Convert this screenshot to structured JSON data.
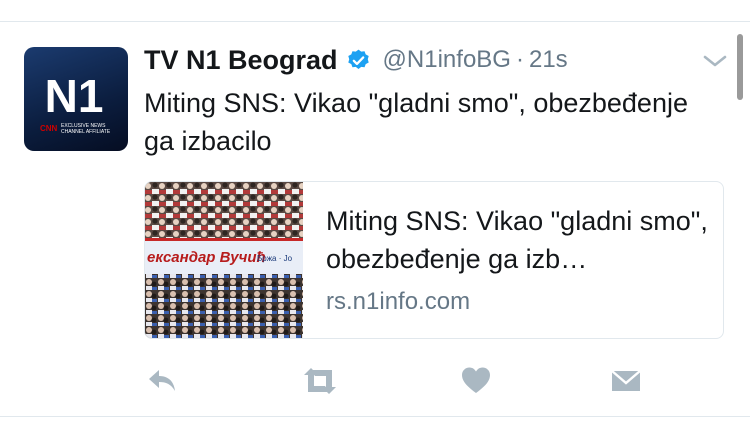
{
  "tweet": {
    "display_name": "TV N1 Beograd",
    "verified": true,
    "handle": "@N1infoBG",
    "separator": "·",
    "time": "21s",
    "text": "Miting SNS: Vikao \"gladni smo\", obezbeđenje ga izbacilo"
  },
  "avatar": {
    "logo_text": "N1",
    "sub_brand": "CNN",
    "affiliate_line1": "EXCLUSIVE NEWS",
    "affiliate_line2": "CHANNEL AFFILIATE"
  },
  "card": {
    "title": "Miting SNS: Vikao \"gladni smo\", obezbeđenje ga izb…",
    "domain": "rs.n1info.com",
    "image_banner_text": "ексaндар Вучић",
    "image_banner_small": "Бржа · Јо"
  },
  "actions": [
    {
      "name": "reply",
      "icon": "reply-icon"
    },
    {
      "name": "retweet",
      "icon": "retweet-icon"
    },
    {
      "name": "like",
      "icon": "heart-icon"
    },
    {
      "name": "direct-message",
      "icon": "envelope-icon"
    }
  ],
  "colors": {
    "text_primary": "#14171a",
    "text_secondary": "#657786",
    "verified_blue": "#1da1f2",
    "action_icon": "#aab8c2",
    "divider": "#e1e8ed",
    "logo_blue": "#2aa8e0",
    "cnn_red": "#cc0000"
  }
}
